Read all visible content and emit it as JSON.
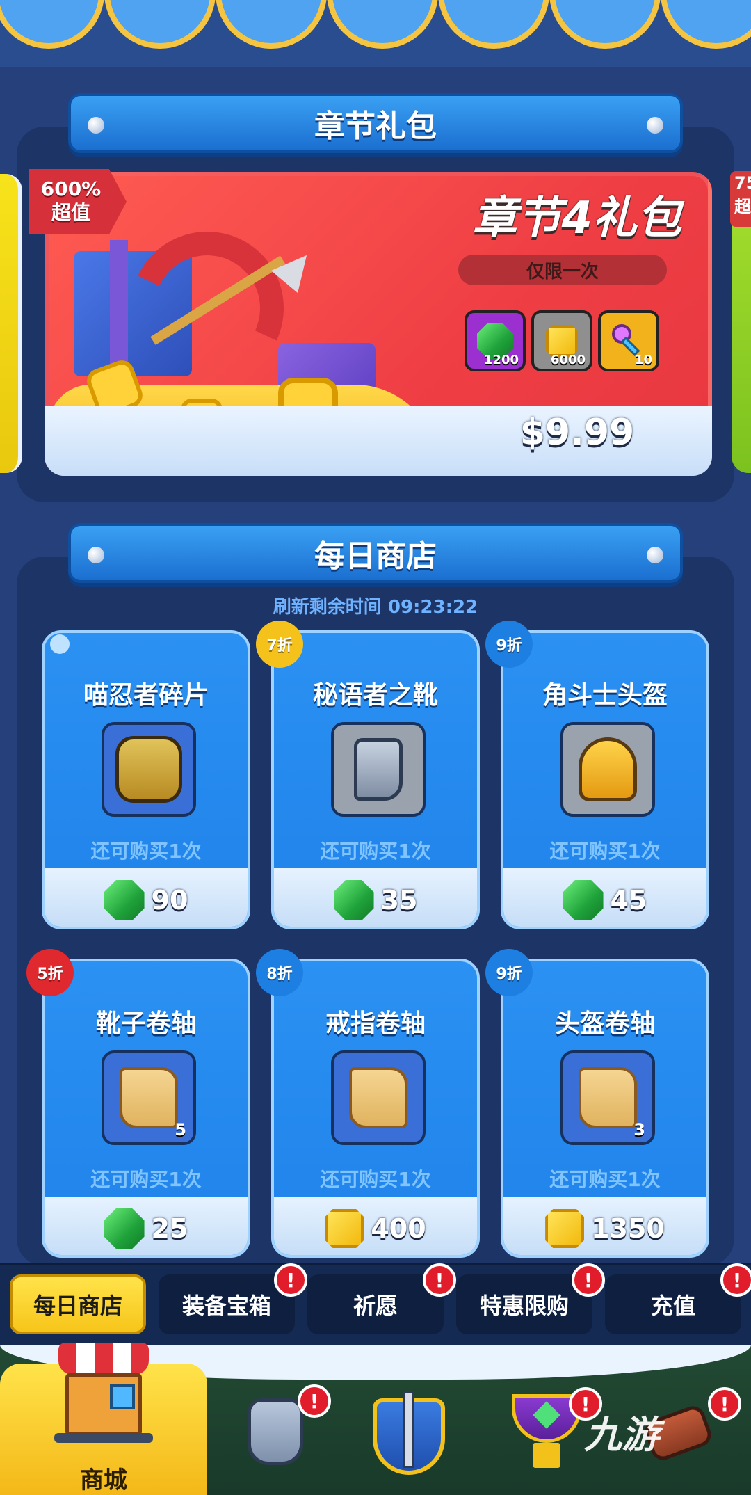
{
  "chapter_section": {
    "title": "章节礼包",
    "pack": {
      "badge_line1": "600%",
      "badge_line2": "超值",
      "title": "章节4礼包",
      "limit": "仅限一次",
      "rewards": [
        {
          "type": "gem",
          "icon": "gem-icon",
          "count": "1200",
          "bg": "#9b2fd0"
        },
        {
          "type": "coin",
          "icon": "coin-icon",
          "count": "6000",
          "bg": "#8f8f8f"
        },
        {
          "type": "key",
          "icon": "key-icon",
          "count": "10",
          "bg": "#f1b21b"
        }
      ],
      "price": "$9.99"
    },
    "side_right_badge_line1": "75",
    "side_right_badge_line2": "超"
  },
  "daily_section": {
    "title": "每日商店",
    "refresh": "刷新剩余时间 09:23:22",
    "items": [
      {
        "name": "喵忍者碎片",
        "discount": "",
        "icon": "ninja-cat-shard-icon",
        "icon_bg": "#3a6fd8",
        "limit": "还可购买1次",
        "currency": "gem",
        "price": "90",
        "qty": ""
      },
      {
        "name": "秘语者之靴",
        "discount": "7折",
        "discount_color": "#f5c21b",
        "icon": "boots-icon",
        "icon_bg": "#9aa3ad",
        "limit": "还可购买1次",
        "currency": "gem",
        "price": "35",
        "qty": ""
      },
      {
        "name": "角斗士头盔",
        "discount": "9折",
        "discount_color": "#1e7fe3",
        "icon": "helmet-icon",
        "icon_bg": "#9aa3ad",
        "limit": "还可购买1次",
        "currency": "gem",
        "price": "45",
        "qty": ""
      },
      {
        "name": "靴子卷轴",
        "discount": "5折",
        "discount_color": "#e0282f",
        "icon": "boots-scroll-icon",
        "icon_bg": "#3a6fd8",
        "limit": "还可购买1次",
        "currency": "gem",
        "price": "25",
        "qty": "5"
      },
      {
        "name": "戒指卷轴",
        "discount": "8折",
        "discount_color": "#1e7fe3",
        "icon": "ring-scroll-icon",
        "icon_bg": "#3a6fd8",
        "limit": "还可购买1次",
        "currency": "coin",
        "price": "400",
        "qty": ""
      },
      {
        "name": "头盔卷轴",
        "discount": "9折",
        "discount_color": "#1e7fe3",
        "icon": "helmet-scroll-icon",
        "icon_bg": "#3a6fd8",
        "limit": "还可购买1次",
        "currency": "coin",
        "price": "1350",
        "qty": "3"
      }
    ]
  },
  "tabs": [
    {
      "label": "每日商店",
      "active": true,
      "alert": false
    },
    {
      "label": "装备宝箱",
      "active": false,
      "alert": true
    },
    {
      "label": "祈愿",
      "active": false,
      "alert": true
    },
    {
      "label": "特惠限购",
      "active": false,
      "alert": true
    },
    {
      "label": "充值",
      "active": false,
      "alert": true
    }
  ],
  "alert_mark": "!",
  "bottom_nav": {
    "active_label": "商城",
    "items": [
      {
        "icon": "shop-stall-icon",
        "active": true,
        "alert": false
      },
      {
        "icon": "armor-icon",
        "active": false,
        "alert": true
      },
      {
        "icon": "shield-sword-icon",
        "active": false,
        "alert": false
      },
      {
        "icon": "trophy-icon",
        "active": false,
        "alert": true
      },
      {
        "icon": "hammer-icon",
        "active": false,
        "alert": true
      }
    ]
  },
  "watermark": "九游"
}
